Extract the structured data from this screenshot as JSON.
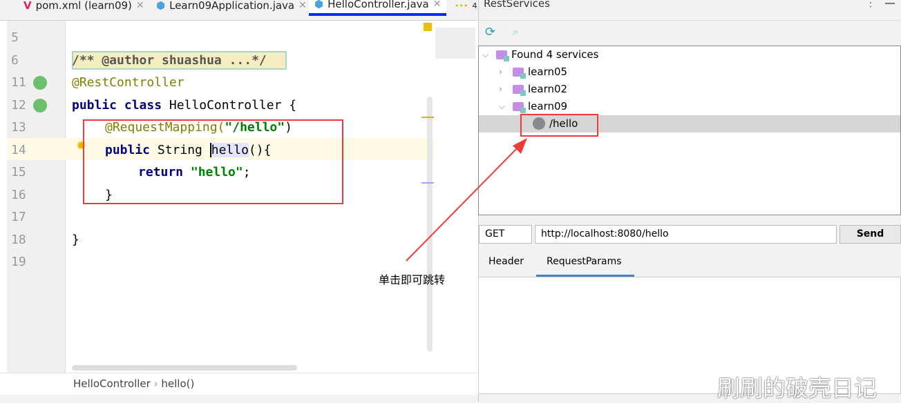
{
  "tabs": [
    {
      "label": "pom.xml (learn09)",
      "icon": "maven-icon"
    },
    {
      "label": "Learn09Application.java",
      "icon": "spring-class-icon"
    },
    {
      "label": "HelloController.java",
      "icon": "class-icon",
      "active": true
    },
    {
      "label": "4",
      "icon": "more-tabs-icon"
    }
  ],
  "editor": {
    "lines": [
      {
        "n": "5"
      },
      {
        "n": "6"
      },
      {
        "n": "11"
      },
      {
        "n": "12"
      },
      {
        "n": "13"
      },
      {
        "n": "14"
      },
      {
        "n": "15"
      },
      {
        "n": "16"
      },
      {
        "n": "17"
      },
      {
        "n": "18"
      },
      {
        "n": "19"
      }
    ],
    "code": {
      "comment": "/** @author shuashua ...*/",
      "ann1": "@RestController",
      "l12a": "public class",
      "l12b": " HelloController {",
      "ann2": "@RequestMapping(",
      "str1": "\"/hello\"",
      "paren": ")",
      "l14a": "public",
      "l14b": " String ",
      "l14c": "hello",
      "l14d": "(){",
      "ret": "return",
      "str2": "\"hello\"",
      "semi": ";",
      "close1": "}",
      "close2": "}"
    }
  },
  "breadcrumb": [
    "HelloController",
    "hello()"
  ],
  "rest": {
    "title": "RestServices",
    "root": "Found 4 services",
    "modules": [
      "learn05",
      "learn02",
      "learn09"
    ],
    "endpoint": "/hello",
    "method": "GET",
    "url": "http://localhost:8080/hello",
    "send": "Send",
    "tabs": [
      "Header",
      "RequestParams"
    ]
  },
  "annotation": "单击即可跳转",
  "watermark": "刷刷的破壳日记",
  "colors": {
    "highlight": "#f03a3a",
    "accent": "#0a2bef"
  }
}
